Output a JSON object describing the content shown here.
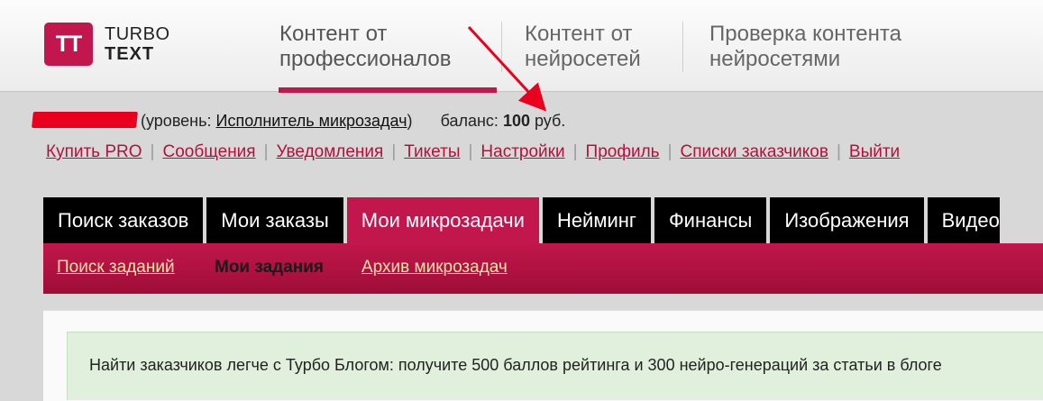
{
  "header": {
    "logo_mark": "TT",
    "logo_line1": "TURBO",
    "logo_line2": "TEXT",
    "nav": [
      {
        "label": "Контент от\nпрофессионалов",
        "active": true
      },
      {
        "label": "Контент от\nнейросетей",
        "active": false
      },
      {
        "label": "Проверка контента\nнейросетями",
        "active": false
      }
    ]
  },
  "user": {
    "level_prefix": "(уровень: ",
    "level": "Исполнитель микрозадач",
    "level_suffix": ")",
    "balance_label": "баланс: ",
    "balance_value": "100",
    "balance_unit": " руб."
  },
  "links": [
    "Купить PRO",
    "Сообщения",
    "Уведомления",
    "Тикеты",
    "Настройки",
    "Профиль",
    "Списки заказчиков",
    "Выйти"
  ],
  "links_separator": "|",
  "tabs": [
    {
      "label": "Поиск заказов",
      "active": false
    },
    {
      "label": "Мои заказы",
      "active": false
    },
    {
      "label": "Мои микрозадачи",
      "active": true
    },
    {
      "label": "Нейминг",
      "active": false
    },
    {
      "label": "Финансы",
      "active": false
    },
    {
      "label": "Изображения",
      "active": false
    },
    {
      "label": "Видео",
      "active": false
    }
  ],
  "subtabs": [
    {
      "label": "Поиск заданий",
      "current": false
    },
    {
      "label": "Мои задания",
      "current": true
    },
    {
      "label": "Архив микрозадач",
      "current": false
    }
  ],
  "notice": "Найти заказчиков легче с Турбо Блогом: получите 500 баллов рейтинга и 300 нейро-генераций за статьи в блоге",
  "colors": {
    "brand": "#c2174c",
    "link": "#b0123f",
    "sublink": "#fde3a7",
    "annotation": "#e8001e"
  }
}
